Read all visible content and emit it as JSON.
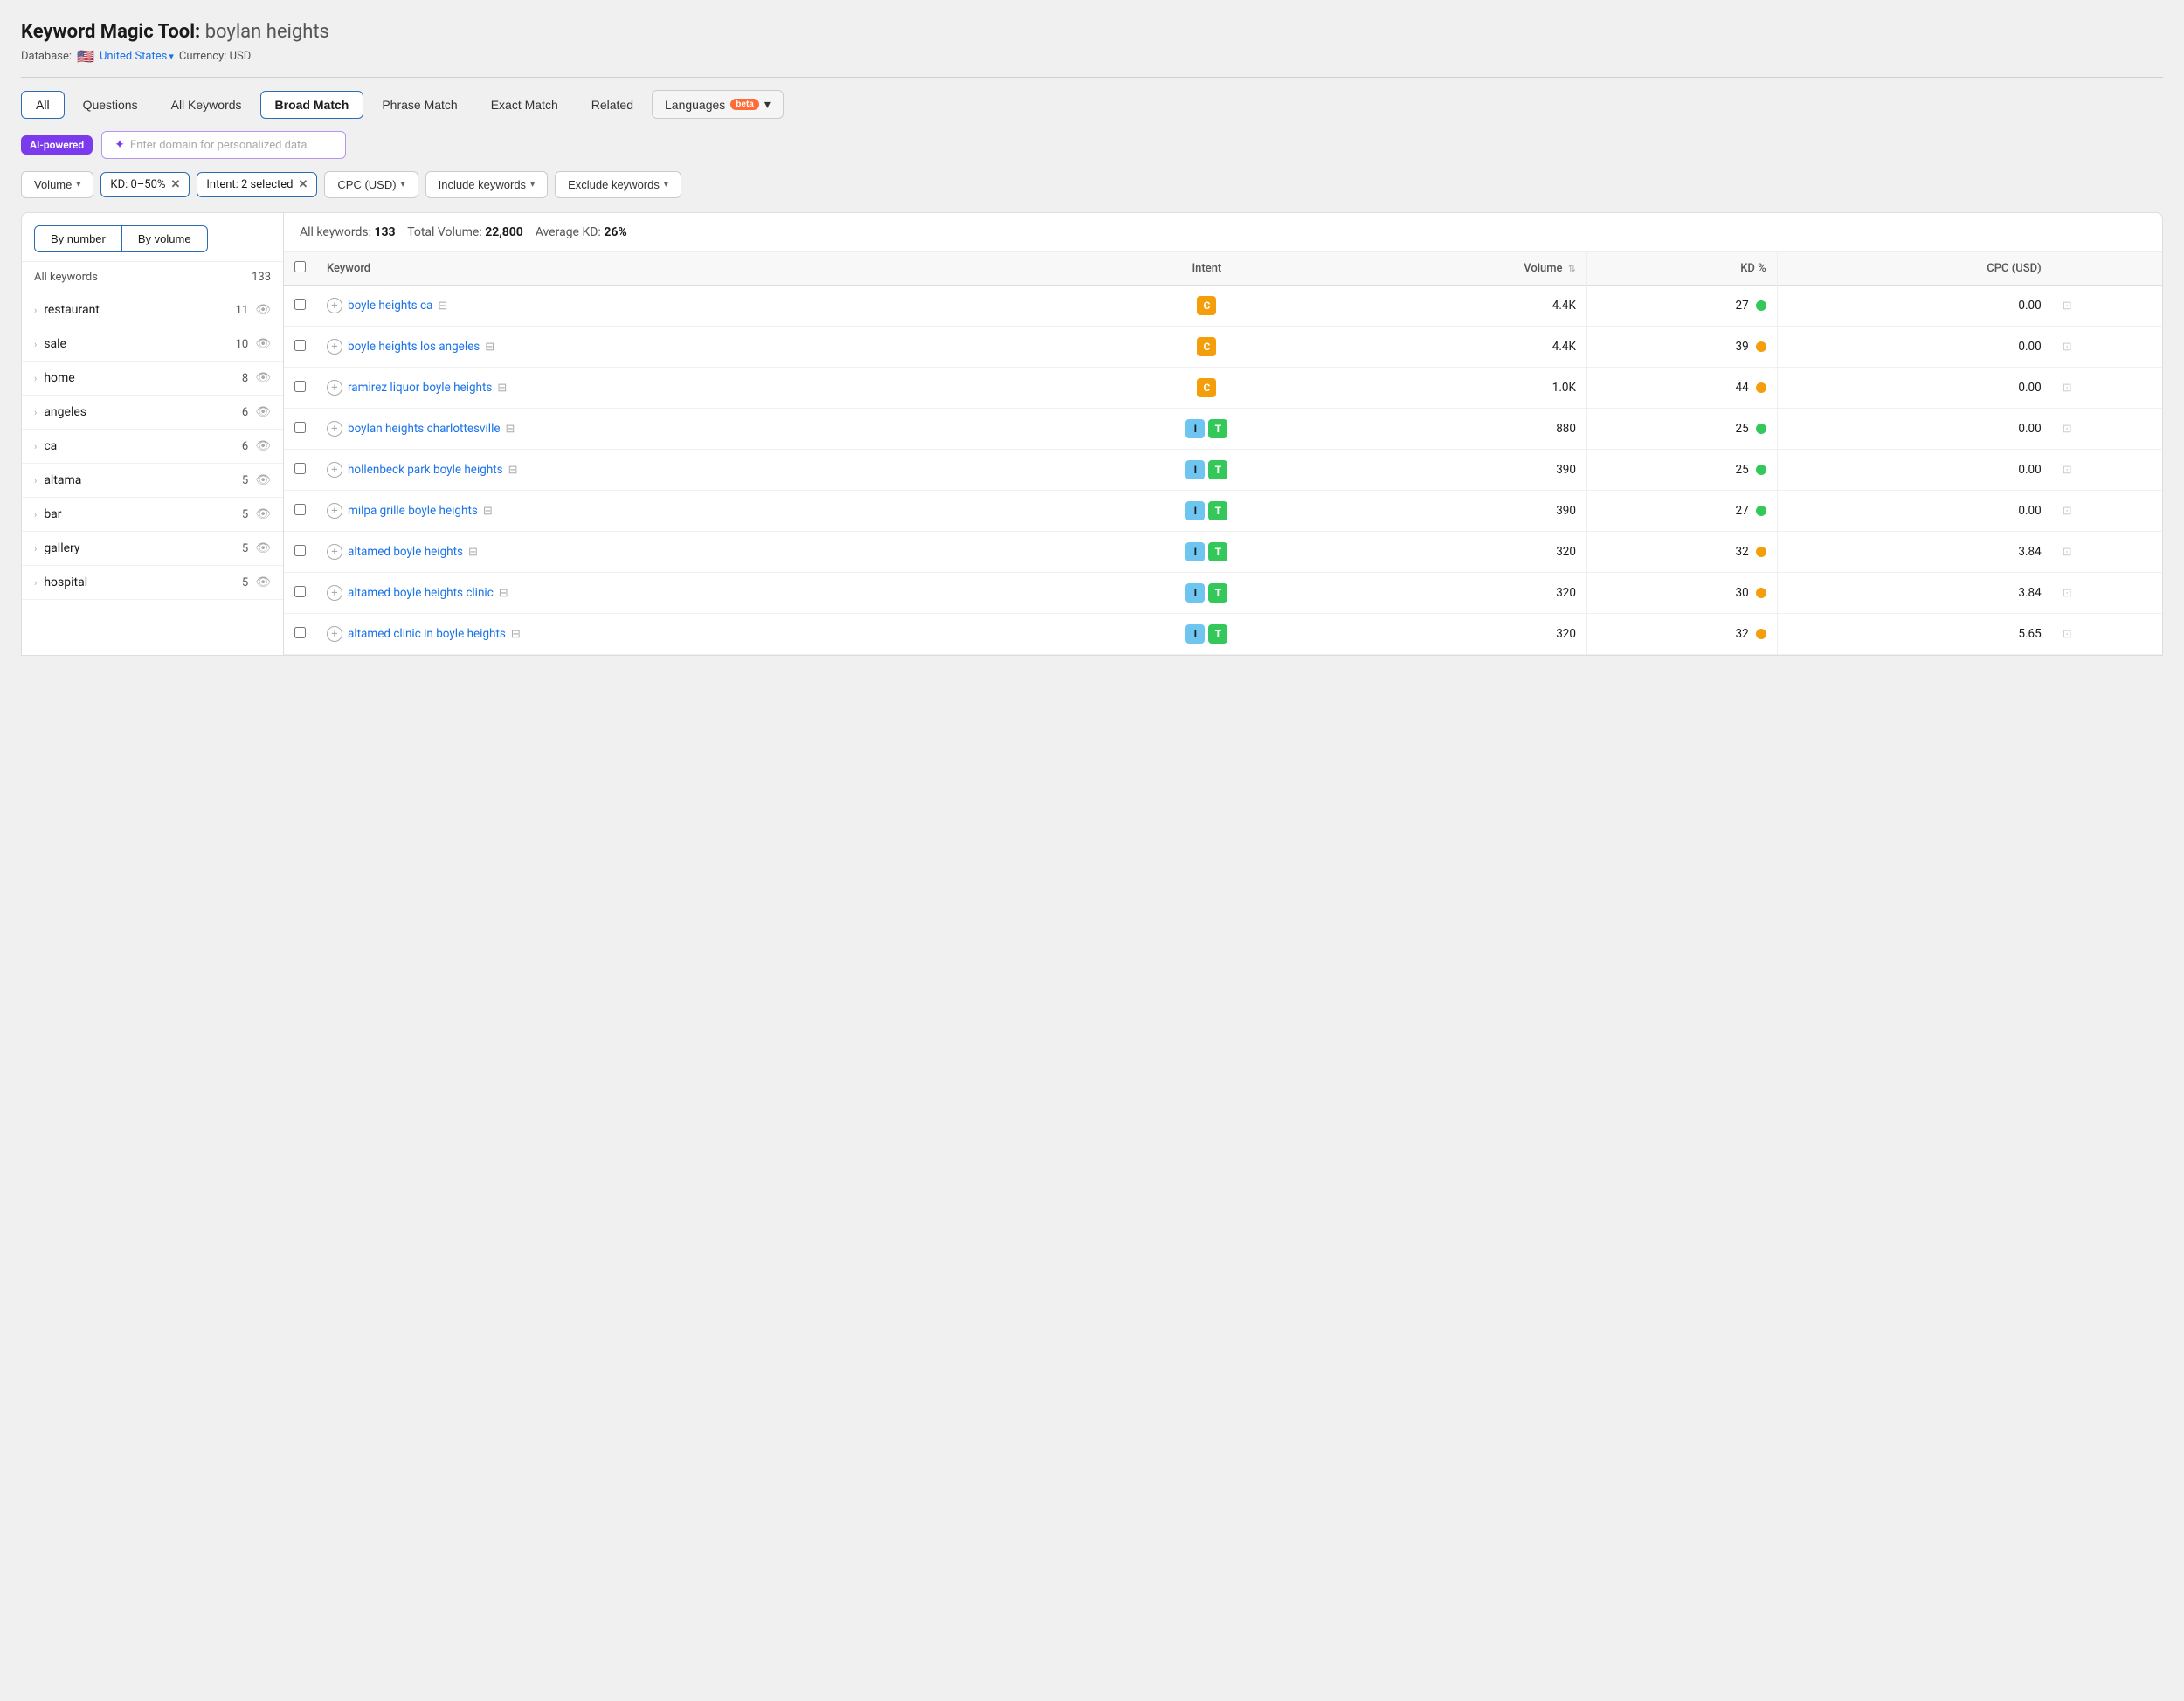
{
  "header": {
    "tool_label": "Keyword Magic Tool:",
    "keyword": "boylan heights",
    "database_label": "Database:",
    "flag": "🇺🇸",
    "database_link": "United States",
    "currency_label": "Currency: USD"
  },
  "tabs": [
    {
      "id": "all",
      "label": "All",
      "active": true
    },
    {
      "id": "questions",
      "label": "Questions",
      "active": false
    },
    {
      "id": "all-keywords",
      "label": "All Keywords",
      "active": false
    },
    {
      "id": "broad-match",
      "label": "Broad Match",
      "active": true
    },
    {
      "id": "phrase-match",
      "label": "Phrase Match",
      "active": false
    },
    {
      "id": "exact-match",
      "label": "Exact Match",
      "active": false
    },
    {
      "id": "related",
      "label": "Related",
      "active": false
    }
  ],
  "languages_btn": "Languages",
  "beta_badge": "beta",
  "ai": {
    "badge": "AI-powered",
    "placeholder": "Enter domain for personalized data"
  },
  "filters": {
    "volume_label": "Volume",
    "kd_chip": "KD: 0–50%",
    "intent_chip": "Intent: 2 selected",
    "cpc_label": "CPC (USD)",
    "include_label": "Include keywords",
    "exclude_label": "Exclude keywords"
  },
  "sidebar": {
    "toggle_number": "By number",
    "toggle_volume": "By volume",
    "header_col1": "All keywords",
    "header_col2": "133",
    "items": [
      {
        "label": "restaurant",
        "count": "11"
      },
      {
        "label": "sale",
        "count": "10"
      },
      {
        "label": "home",
        "count": "8"
      },
      {
        "label": "angeles",
        "count": "6"
      },
      {
        "label": "ca",
        "count": "6"
      },
      {
        "label": "altama",
        "count": "5"
      },
      {
        "label": "bar",
        "count": "5"
      },
      {
        "label": "gallery",
        "count": "5"
      },
      {
        "label": "hospital",
        "count": "5"
      }
    ]
  },
  "summary": {
    "all_keywords_label": "All keywords:",
    "all_keywords_value": "133",
    "total_volume_label": "Total Volume:",
    "total_volume_value": "22,800",
    "avg_kd_label": "Average KD:",
    "avg_kd_value": "26%"
  },
  "table": {
    "columns": [
      {
        "id": "keyword",
        "label": "Keyword"
      },
      {
        "id": "intent",
        "label": "Intent",
        "align": "center"
      },
      {
        "id": "volume",
        "label": "Volume",
        "align": "right",
        "sortable": true
      },
      {
        "id": "kd",
        "label": "KD %",
        "align": "right"
      },
      {
        "id": "cpc",
        "label": "CPC (USD)",
        "align": "right"
      }
    ],
    "rows": [
      {
        "keyword": "boyle heights ca",
        "intent": [
          "C"
        ],
        "intent_types": [
          "c"
        ],
        "volume": "4.4K",
        "kd": "27",
        "kd_color": "green",
        "cpc": "0.00"
      },
      {
        "keyword": "boyle heights los angeles",
        "intent": [
          "C"
        ],
        "intent_types": [
          "c"
        ],
        "volume": "4.4K",
        "kd": "39",
        "kd_color": "yellow",
        "cpc": "0.00"
      },
      {
        "keyword": "ramirez liquor boyle heights",
        "intent": [
          "C"
        ],
        "intent_types": [
          "c"
        ],
        "volume": "1.0K",
        "kd": "44",
        "kd_color": "yellow",
        "cpc": "0.00"
      },
      {
        "keyword": "boylan heights charlottesville",
        "intent": [
          "I",
          "T"
        ],
        "intent_types": [
          "i",
          "t"
        ],
        "volume": "880",
        "kd": "25",
        "kd_color": "green",
        "cpc": "0.00"
      },
      {
        "keyword": "hollenbeck park boyle heights",
        "intent": [
          "I",
          "T"
        ],
        "intent_types": [
          "i",
          "t"
        ],
        "volume": "390",
        "kd": "25",
        "kd_color": "green",
        "cpc": "0.00"
      },
      {
        "keyword": "milpa grille boyle heights",
        "intent": [
          "I",
          "T"
        ],
        "intent_types": [
          "i",
          "t"
        ],
        "volume": "390",
        "kd": "27",
        "kd_color": "green",
        "cpc": "0.00"
      },
      {
        "keyword": "altamed boyle heights",
        "intent": [
          "I",
          "T"
        ],
        "intent_types": [
          "i",
          "t"
        ],
        "volume": "320",
        "kd": "32",
        "kd_color": "yellow",
        "cpc": "3.84"
      },
      {
        "keyword": "altamed boyle heights clinic",
        "intent": [
          "I",
          "T"
        ],
        "intent_types": [
          "i",
          "t"
        ],
        "volume": "320",
        "kd": "30",
        "kd_color": "yellow",
        "cpc": "3.84"
      },
      {
        "keyword": "altamed clinic in boyle heights",
        "intent": [
          "I",
          "T"
        ],
        "intent_types": [
          "i",
          "t"
        ],
        "volume": "320",
        "kd": "32",
        "kd_color": "yellow",
        "cpc": "5.65"
      }
    ]
  }
}
